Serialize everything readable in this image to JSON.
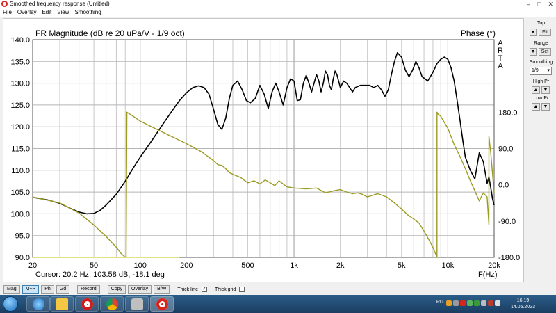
{
  "window": {
    "title": "Smoothed frequency response (Untitled)",
    "controls": [
      "–",
      "□",
      "✕"
    ]
  },
  "menu": [
    "File",
    "Overlay",
    "Edit",
    "View",
    "Smoothing"
  ],
  "chart_data": {
    "type": "line",
    "title": "FR Magnitude (dB re 20 uPa/V - 1/9 oct)",
    "phase_title": "Phase (°)",
    "watermark": [
      "A",
      "R",
      "T",
      "A"
    ],
    "xlabel": "F(Hz)",
    "xscale": "log",
    "xlim": [
      20,
      20000
    ],
    "x_ticks": [
      20,
      50,
      100,
      200,
      500,
      1000,
      2000,
      5000,
      10000,
      20000
    ],
    "x_tick_labels": [
      "20",
      "50",
      "100",
      "200",
      "500",
      "1k",
      "2k",
      "5k",
      "10k",
      "20k"
    ],
    "ylim": [
      90,
      140
    ],
    "y_ticks": [
      "90.0",
      "95.0",
      "100.0",
      "105.0",
      "110.0",
      "115.0",
      "120.0",
      "125.0",
      "130.0",
      "135.0",
      "140.0"
    ],
    "y2lim": [
      -180,
      360
    ],
    "y2_ticks": [
      "-180.0",
      "-90.0",
      "0.0",
      "90.0",
      "180.0"
    ],
    "grid": true,
    "series": [
      {
        "color": "#000000",
        "x": [
          20,
          25,
          30,
          35,
          40,
          45,
          50,
          55,
          60,
          70,
          80,
          90,
          100,
          120,
          140,
          160,
          180,
          200,
          220,
          240,
          260,
          280,
          300,
          320,
          340,
          360,
          380,
          400,
          430,
          460,
          490,
          520,
          560,
          600,
          640,
          680,
          720,
          760,
          800,
          850,
          900,
          950,
          1000,
          1050,
          1100,
          1150,
          1200,
          1250,
          1300,
          1350,
          1400,
          1450,
          1500,
          1550,
          1600,
          1650,
          1700,
          1750,
          1800,
          1850,
          1900,
          1950,
          2000,
          2100,
          2200,
          2300,
          2400,
          2500,
          2700,
          2900,
          3100,
          3300,
          3500,
          3700,
          3900,
          4100,
          4300,
          4500,
          4700,
          5000,
          5300,
          5600,
          5900,
          6200,
          6500,
          6800,
          7100,
          7400,
          7700,
          8000,
          8500,
          9000,
          9500,
          10000,
          10500,
          11000,
          11500,
          12000,
          12500,
          13000,
          14000,
          15000,
          16000,
          17000,
          18000,
          18500,
          19000,
          19500,
          20000
        ],
        "y": [
          103.8,
          103.2,
          102.4,
          101.3,
          100.4,
          100.0,
          100.1,
          100.8,
          102.0,
          104.5,
          107.5,
          110.5,
          113.0,
          117.0,
          120.5,
          123.5,
          126.0,
          127.8,
          129.0,
          129.4,
          129.0,
          127.5,
          124.0,
          120.5,
          119.4,
          122.0,
          126.5,
          129.5,
          130.5,
          128.5,
          126.0,
          125.5,
          126.5,
          129.5,
          127.5,
          124.2,
          128.0,
          130.0,
          128.0,
          125.0,
          129.0,
          131.0,
          130.5,
          126.0,
          126.2,
          130.0,
          131.8,
          130.0,
          128.0,
          130.0,
          132.0,
          130.5,
          128.0,
          130.0,
          132.8,
          132.0,
          129.5,
          128.5,
          131.0,
          132.8,
          132.0,
          130.5,
          129.0,
          130.5,
          130.0,
          129.0,
          128.0,
          129.0,
          129.5,
          129.5,
          129.5,
          129.0,
          129.5,
          128.5,
          127.0,
          128.5,
          132.0,
          135.0,
          137.0,
          136.0,
          133.0,
          131.5,
          133.0,
          135.0,
          133.5,
          131.5,
          131.0,
          130.5,
          131.5,
          132.5,
          134.5,
          135.5,
          136.0,
          135.5,
          133.5,
          130.5,
          126.0,
          121.5,
          117.0,
          113.0,
          110.0,
          108.0,
          114.0,
          112.0,
          107.0,
          108.5,
          106.0,
          103.5,
          102.0
        ]
      },
      {
        "color": "#9b9b22",
        "axis": "phase",
        "x": [
          20,
          30,
          40,
          50,
          60,
          70,
          75,
          80,
          81,
          82,
          90,
          100,
          150,
          200,
          250,
          300,
          320,
          340,
          360,
          380,
          400,
          450,
          500,
          550,
          600,
          650,
          700,
          750,
          800,
          850,
          900,
          1000,
          1200,
          1400,
          1600,
          1800,
          2000,
          2200,
          2400,
          2600,
          2800,
          3000,
          3500,
          4000,
          4500,
          5000,
          5500,
          6000,
          6500,
          7000,
          7500,
          8000,
          8300,
          8500,
          8501,
          8600,
          9000,
          10000,
          11000,
          12000,
          13000,
          14000,
          15000,
          16000,
          17000,
          18000,
          18500,
          18501,
          19000,
          20000
        ],
        "y": [
          -30,
          -45,
          -70,
          -100,
          -128,
          -155,
          -170,
          -180,
          -178,
          180,
          170,
          158,
          125,
          102,
          82,
          60,
          50,
          48,
          40,
          30,
          26,
          18,
          5,
          10,
          2,
          12,
          5,
          -2,
          10,
          2,
          -5,
          -8,
          -10,
          -8,
          -20,
          -15,
          -12,
          -18,
          -22,
          -20,
          -24,
          -30,
          -22,
          -30,
          -45,
          -60,
          -75,
          -85,
          -95,
          -115,
          -135,
          -155,
          -170,
          -180,
          180,
          176,
          170,
          140,
          100,
          70,
          40,
          10,
          -15,
          -40,
          -20,
          -30,
          -100,
          120,
          80,
          -20
        ]
      },
      {
        "color": "#d9d95a",
        "axis": "phase",
        "x": [
          20,
          30,
          40,
          50,
          60,
          70,
          80,
          82,
          100,
          150,
          180
        ],
        "y": [
          -180,
          -180,
          -180,
          -180,
          -180,
          -180,
          -180,
          -180,
          -180,
          -180,
          -180
        ]
      }
    ]
  },
  "cursor": {
    "text": "Cursor: 20.2 Hz, 103.58 dB, -18.1 deg"
  },
  "side": {
    "top_label": "Top",
    "fit_button": "Fit",
    "range_label": "Range",
    "set_button": "Set",
    "smoothing_label": "Smoothing",
    "smoothing_value": "1/9",
    "highpr_label": "High Pr",
    "lowpr_label": "Low Pr",
    "up": "▲",
    "down": "▼"
  },
  "toolbar": {
    "buttons": [
      "Mag",
      "M+P",
      "Ph",
      "Gd",
      "Record",
      "Copy",
      "Overlay",
      "B/W"
    ],
    "active": "M+P",
    "thick_line_label": "Thick line",
    "thick_grid_label": "Thick grid"
  },
  "taskbar": {
    "lang": "RU",
    "time": "16:19",
    "date": "14.05.2023"
  }
}
